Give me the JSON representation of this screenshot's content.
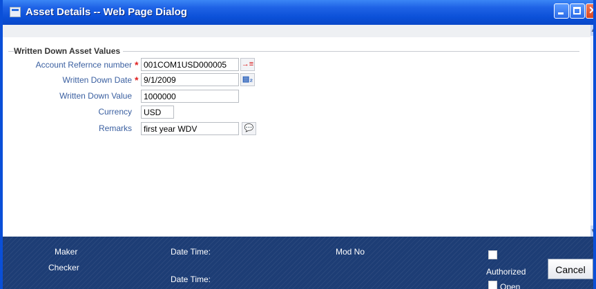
{
  "window": {
    "title": "Asset Details -- Web Page Dialog"
  },
  "section": {
    "title": "Written Down Asset Values"
  },
  "fields": {
    "account_ref": {
      "label": "Account Refernce number",
      "value": "001COM1USD000005",
      "required_mark": "*"
    },
    "wd_date": {
      "label": "Written Down Date",
      "value": "9/1/2009",
      "required_mark": "*"
    },
    "wd_value": {
      "label": "Written Down Value",
      "value": "1000000"
    },
    "currency": {
      "label": "Currency",
      "value": "USD"
    },
    "remarks": {
      "label": "Remarks",
      "value": "first year WDV"
    }
  },
  "footer": {
    "maker": "Maker",
    "checker": "Checker",
    "date_time_1": "Date Time:",
    "date_time_2": "Date Time:",
    "mod_no": "Mod No",
    "authorized": "Authorized",
    "open": "Open",
    "cancel": "Cancel"
  },
  "icons": {
    "lov": "list-of-values-icon",
    "calendar": "calendar-icon",
    "remarks": "speech-bubble-icon"
  },
  "colors": {
    "titlebar": "#0b50d8",
    "label": "#3a5fa0",
    "required": "#e02020",
    "footer": "#1d3d75"
  }
}
